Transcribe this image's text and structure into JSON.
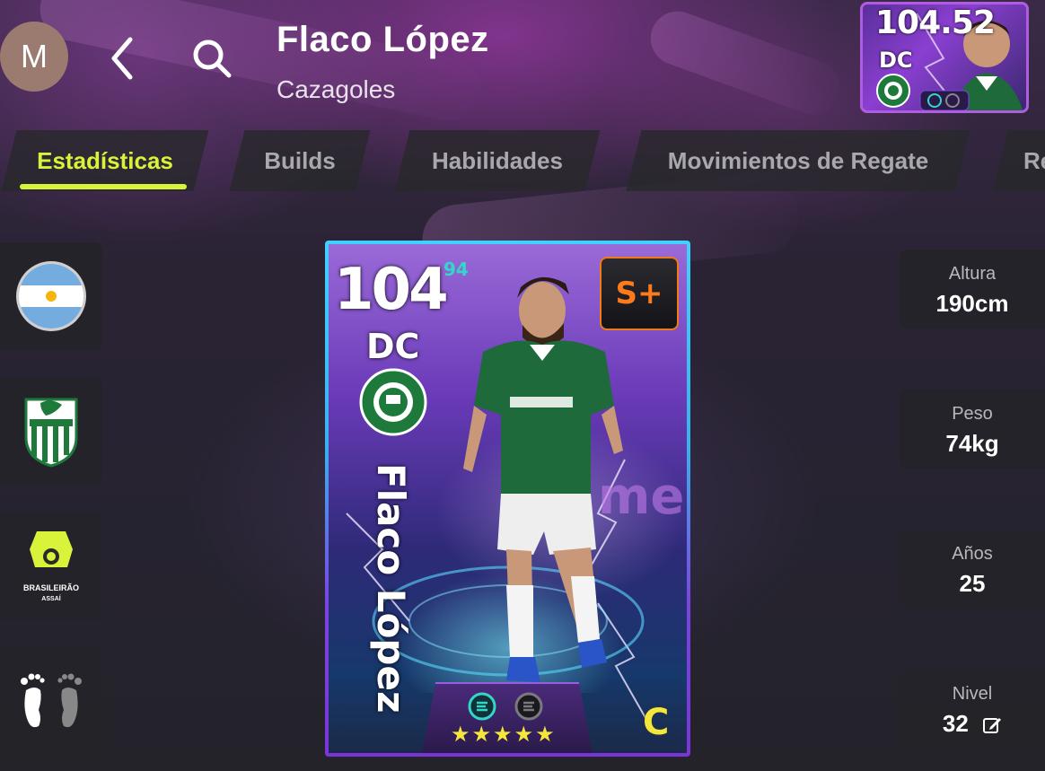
{
  "header": {
    "avatar_letter": "M",
    "player_name": "Flaco López",
    "player_role": "Cazagoles"
  },
  "mini_card": {
    "rating": "104.52",
    "position": "DC"
  },
  "tabs": [
    {
      "label": "Estadísticas",
      "active": true
    },
    {
      "label": "Builds",
      "active": false
    },
    {
      "label": "Habilidades",
      "active": false
    },
    {
      "label": "Movimientos de Regate",
      "active": false
    },
    {
      "label": "Re",
      "active": false
    }
  ],
  "side": {
    "nationality_icon": "argentina-flag-icon",
    "club_icon": "barra-club-crest-icon",
    "league_icon": "brasileirao-league-icon",
    "league_text_1": "BRASILEIRÃO",
    "league_text_2": "ASSAÍ",
    "foot_icon": "footedness-icon"
  },
  "card": {
    "rating": "104",
    "base_rating": "94",
    "position": "DC",
    "name": "Flaco López",
    "grade": "S+",
    "stars": "★★★★★",
    "corner_letter": "C",
    "club_badge": "palmeiras-crest-icon"
  },
  "stats": [
    {
      "label": "Altura",
      "value": "190cm"
    },
    {
      "label": "Peso",
      "value": "74kg"
    },
    {
      "label": "Años",
      "value": "25"
    },
    {
      "label": "Nivel",
      "value": "32"
    }
  ],
  "colors": {
    "accent": "#d9f23a",
    "grade": "#ff7a1a",
    "tab_bg": "#2a2a2e",
    "card_border": "#3fd2ff"
  }
}
